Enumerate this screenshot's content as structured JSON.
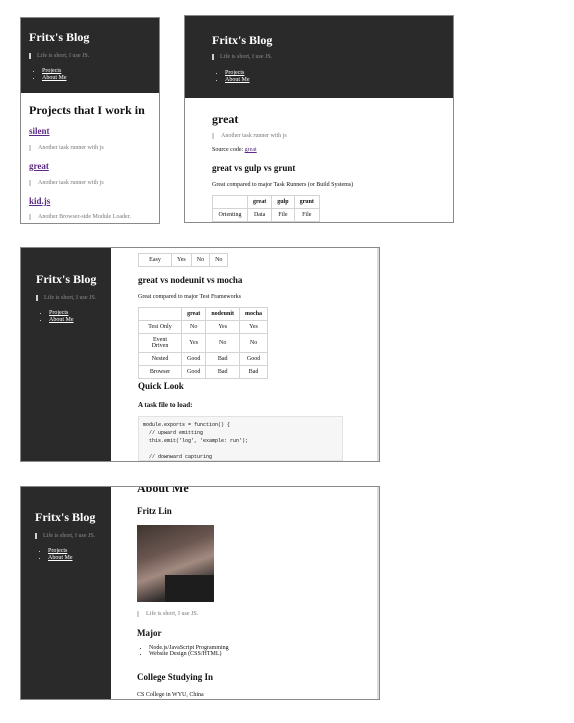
{
  "blog": {
    "title": "Fritx's Blog",
    "tagline": "Life is short, I use JS.",
    "nav": [
      "Projects",
      "About Me"
    ]
  },
  "projects_page": {
    "heading": "Projects that I work in",
    "items": [
      {
        "name": "silent",
        "desc": "Another task runner with js"
      },
      {
        "name": "great",
        "desc": "Another task runner with js"
      },
      {
        "name": "kid.js",
        "desc": "Another Browser-side Module Loader."
      }
    ]
  },
  "great_page": {
    "heading": "great",
    "desc": "Another task runner with js",
    "source_label": "Source code:",
    "source_link": "great",
    "compare1_heading": "great vs gulp vs grunt",
    "compare1_text": "Great compared to major Task Runners (or Build Systems)",
    "table1_headers": [
      "",
      "great",
      "gulp",
      "grunt"
    ],
    "table1_rows": [
      [
        "Orienting",
        "Data",
        "File",
        "File"
      ]
    ]
  },
  "great_page2": {
    "partial_row": [
      "Easy",
      "Yes",
      "No",
      "No"
    ],
    "compare2_heading": "great vs nodeunit vs mocha",
    "compare2_text": "Great compared to major Test Frameworks",
    "table2_headers": [
      "",
      "great",
      "nodeunit",
      "mocha"
    ],
    "table2_rows": [
      [
        "Test Only",
        "No",
        "Yes",
        "Yes"
      ],
      [
        "Event Driven",
        "Yes",
        "No",
        "No"
      ],
      [
        "Nested",
        "Good",
        "Bad",
        "Good"
      ],
      [
        "Browser",
        "Good",
        "Bad",
        "Bad"
      ]
    ],
    "quick_heading": "Quick Look",
    "task_heading": "A task file to load:",
    "code": "module.exports = function() {\n  // upward emitting\n  this.emit('log', 'example: run');\n\n  // downward capturing\n  this.capture('title', function (title) {"
  },
  "about_page": {
    "heading": "About Me",
    "name": "Fritz Lin",
    "quote": "Life is short, I use JS.",
    "major_heading": "Major",
    "majors": [
      "Node.js/JavaScript Programming",
      "Website Design (CSS/HTML)"
    ],
    "college_heading": "College Studying In",
    "college": "CS College in WYU, China"
  },
  "colors": {
    "sidebar": "#2a2a2a",
    "link": "#5b2a86",
    "quote_border": "#cfcfcf"
  }
}
